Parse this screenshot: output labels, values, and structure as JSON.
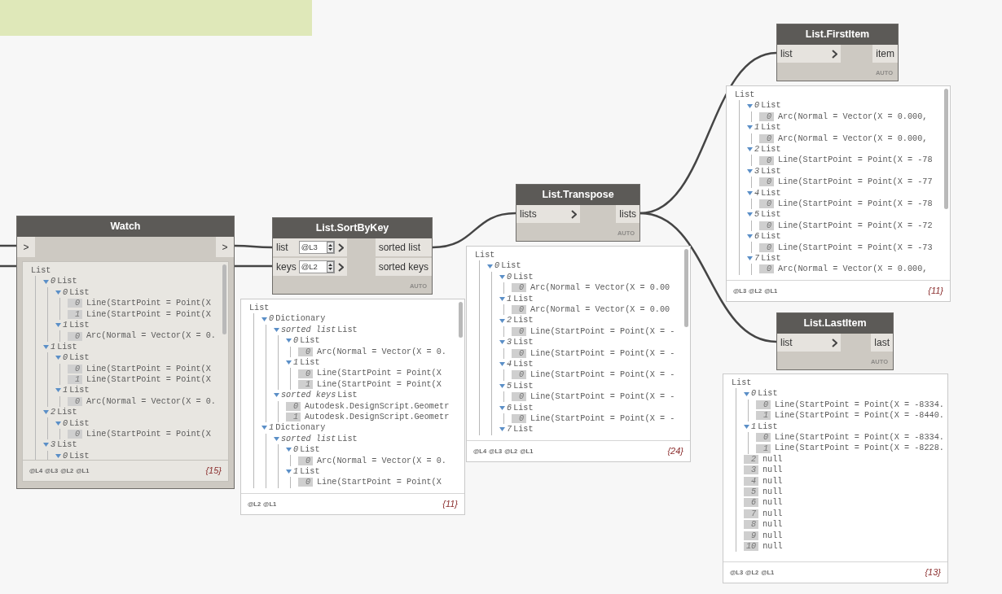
{
  "nodes": [
    {
      "kind": "watch",
      "title": "Watch",
      "inputs": [
        {
          "label": ">"
        }
      ],
      "outputs": [
        {
          "label": ">"
        }
      ],
      "preview": {
        "tree": {
          "kind": "list",
          "text": "List",
          "children": [
            {
              "kind": "list",
              "index": "0",
              "text": "List",
              "children": [
                {
                  "kind": "list",
                  "index": "0",
                  "text": "List",
                  "children": [
                    {
                      "kind": "item",
                      "index": "0",
                      "text": "Line(StartPoint = Point(X"
                    },
                    {
                      "kind": "item",
                      "index": "1",
                      "text": "Line(StartPoint = Point(X"
                    }
                  ]
                },
                {
                  "kind": "list",
                  "index": "1",
                  "text": "List",
                  "children": [
                    {
                      "kind": "item",
                      "index": "0",
                      "text": "Arc(Normal = Vector(X = 0."
                    }
                  ]
                }
              ]
            },
            {
              "kind": "list",
              "index": "1",
              "text": "List",
              "children": [
                {
                  "kind": "list",
                  "index": "0",
                  "text": "List",
                  "children": [
                    {
                      "kind": "item",
                      "index": "0",
                      "text": "Line(StartPoint = Point(X"
                    },
                    {
                      "kind": "item",
                      "index": "1",
                      "text": "Line(StartPoint = Point(X"
                    }
                  ]
                },
                {
                  "kind": "list",
                  "index": "1",
                  "text": "List",
                  "children": [
                    {
                      "kind": "item",
                      "index": "0",
                      "text": "Arc(Normal = Vector(X = 0."
                    }
                  ]
                }
              ]
            },
            {
              "kind": "list",
              "index": "2",
              "text": "List",
              "children": [
                {
                  "kind": "list",
                  "index": "0",
                  "text": "List",
                  "children": [
                    {
                      "kind": "item",
                      "index": "0",
                      "text": "Line(StartPoint = Point(X"
                    }
                  ]
                }
              ]
            },
            {
              "kind": "list",
              "index": "3",
              "text": "List",
              "children": [
                {
                  "kind": "list",
                  "index": "0",
                  "text": "List"
                }
              ]
            }
          ]
        },
        "levels": [
          "@L4",
          "@L3",
          "@L2",
          "@L1"
        ],
        "count": "{15}"
      }
    },
    {
      "kind": "function",
      "title": "List.SortByKey",
      "inputs": [
        {
          "label": "list",
          "lacing": "@L3"
        },
        {
          "label": "keys",
          "lacing": "@L2"
        }
      ],
      "outputs": [
        {
          "label": "sorted list"
        },
        {
          "label": "sorted keys"
        }
      ],
      "mode": "AUTO",
      "preview": {
        "tree": {
          "kind": "list",
          "text": "List",
          "children": [
            {
              "kind": "list",
              "index": "0",
              "text": "Dictionary",
              "children": [
                {
                  "kind": "list",
                  "key": "sorted list",
                  "text": "List",
                  "children": [
                    {
                      "kind": "list",
                      "index": "0",
                      "text": "List",
                      "children": [
                        {
                          "kind": "item",
                          "index": "0",
                          "text": "Arc(Normal = Vector(X = 0."
                        }
                      ]
                    },
                    {
                      "kind": "list",
                      "index": "1",
                      "text": "List",
                      "children": [
                        {
                          "kind": "item",
                          "index": "0",
                          "text": "Line(StartPoint = Point(X"
                        },
                        {
                          "kind": "item",
                          "index": "1",
                          "text": "Line(StartPoint = Point(X"
                        }
                      ]
                    }
                  ]
                },
                {
                  "kind": "list",
                  "key": "sorted keys",
                  "text": "List",
                  "children": [
                    {
                      "kind": "item",
                      "index": "0",
                      "text": "Autodesk.DesignScript.Geometr"
                    },
                    {
                      "kind": "item",
                      "index": "1",
                      "text": "Autodesk.DesignScript.Geometr"
                    }
                  ]
                }
              ]
            },
            {
              "kind": "list",
              "index": "1",
              "text": "Dictionary",
              "children": [
                {
                  "kind": "list",
                  "key": "sorted list",
                  "text": "List",
                  "children": [
                    {
                      "kind": "list",
                      "index": "0",
                      "text": "List",
                      "children": [
                        {
                          "kind": "item",
                          "index": "0",
                          "text": "Arc(Normal = Vector(X = 0."
                        }
                      ]
                    },
                    {
                      "kind": "list",
                      "index": "1",
                      "text": "List",
                      "children": [
                        {
                          "kind": "item",
                          "index": "0",
                          "text": "Line(StartPoint = Point(X"
                        }
                      ]
                    }
                  ]
                }
              ]
            }
          ]
        },
        "levels": [
          "@L2",
          "@L1"
        ],
        "count": "{11}"
      }
    },
    {
      "kind": "function",
      "title": "List.Transpose",
      "inputs": [
        {
          "label": "lists"
        }
      ],
      "outputs": [
        {
          "label": "lists"
        }
      ],
      "mode": "AUTO",
      "preview": {
        "tree": {
          "kind": "list",
          "text": "List",
          "children": [
            {
              "kind": "list",
              "index": "0",
              "text": "List",
              "children": [
                {
                  "kind": "list",
                  "index": "0",
                  "text": "List",
                  "children": [
                    {
                      "kind": "item",
                      "index": "0",
                      "text": "Arc(Normal = Vector(X = 0.00"
                    }
                  ]
                },
                {
                  "kind": "list",
                  "index": "1",
                  "text": "List",
                  "children": [
                    {
                      "kind": "item",
                      "index": "0",
                      "text": "Arc(Normal = Vector(X = 0.00"
                    }
                  ]
                },
                {
                  "kind": "list",
                  "index": "2",
                  "text": "List",
                  "children": [
                    {
                      "kind": "item",
                      "index": "0",
                      "text": "Line(StartPoint = Point(X = -"
                    }
                  ]
                },
                {
                  "kind": "list",
                  "index": "3",
                  "text": "List",
                  "children": [
                    {
                      "kind": "item",
                      "index": "0",
                      "text": "Line(StartPoint = Point(X = -"
                    }
                  ]
                },
                {
                  "kind": "list",
                  "index": "4",
                  "text": "List",
                  "children": [
                    {
                      "kind": "item",
                      "index": "0",
                      "text": "Line(StartPoint = Point(X = -"
                    }
                  ]
                },
                {
                  "kind": "list",
                  "index": "5",
                  "text": "List",
                  "children": [
                    {
                      "kind": "item",
                      "index": "0",
                      "text": "Line(StartPoint = Point(X = -"
                    }
                  ]
                },
                {
                  "kind": "list",
                  "index": "6",
                  "text": "List",
                  "children": [
                    {
                      "kind": "item",
                      "index": "0",
                      "text": "Line(StartPoint = Point(X = -"
                    }
                  ]
                },
                {
                  "kind": "list",
                  "index": "7",
                  "text": "List"
                }
              ]
            }
          ]
        },
        "levels": [
          "@L4",
          "@L3",
          "@L2",
          "@L1"
        ],
        "count": "{24}"
      }
    },
    {
      "kind": "function",
      "title": "List.FirstItem",
      "inputs": [
        {
          "label": "list"
        }
      ],
      "outputs": [
        {
          "label": "item"
        }
      ],
      "mode": "AUTO",
      "preview": {
        "tree": {
          "kind": "list",
          "text": "List",
          "children": [
            {
              "kind": "list",
              "index": "0",
              "text": "List",
              "children": [
                {
                  "kind": "item",
                  "index": "0",
                  "text": "Arc(Normal = Vector(X = 0.000,"
                }
              ]
            },
            {
              "kind": "list",
              "index": "1",
              "text": "List",
              "children": [
                {
                  "kind": "item",
                  "index": "0",
                  "text": "Arc(Normal = Vector(X = 0.000,"
                }
              ]
            },
            {
              "kind": "list",
              "index": "2",
              "text": "List",
              "children": [
                {
                  "kind": "item",
                  "index": "0",
                  "text": "Line(StartPoint = Point(X = -78"
                }
              ]
            },
            {
              "kind": "list",
              "index": "3",
              "text": "List",
              "children": [
                {
                  "kind": "item",
                  "index": "0",
                  "text": "Line(StartPoint = Point(X = -77"
                }
              ]
            },
            {
              "kind": "list",
              "index": "4",
              "text": "List",
              "children": [
                {
                  "kind": "item",
                  "index": "0",
                  "text": "Line(StartPoint = Point(X = -78"
                }
              ]
            },
            {
              "kind": "list",
              "index": "5",
              "text": "List",
              "children": [
                {
                  "kind": "item",
                  "index": "0",
                  "text": "Line(StartPoint = Point(X = -72"
                }
              ]
            },
            {
              "kind": "list",
              "index": "6",
              "text": "List",
              "children": [
                {
                  "kind": "item",
                  "index": "0",
                  "text": "Line(StartPoint = Point(X = -73"
                }
              ]
            },
            {
              "kind": "list",
              "index": "7",
              "text": "List",
              "children": [
                {
                  "kind": "item",
                  "index": "0",
                  "text": "Arc(Normal = Vector(X = 0.000,"
                }
              ]
            }
          ]
        },
        "levels": [
          "@L3",
          "@L2",
          "@L1"
        ],
        "count": "{11}"
      }
    },
    {
      "kind": "function",
      "title": "List.LastItem",
      "inputs": [
        {
          "label": "list"
        }
      ],
      "outputs": [
        {
          "label": "last"
        }
      ],
      "mode": "AUTO",
      "preview": {
        "tree": {
          "kind": "list",
          "text": "List",
          "children": [
            {
              "kind": "list",
              "index": "0",
              "text": "List",
              "children": [
                {
                  "kind": "item",
                  "index": "0",
                  "text": "Line(StartPoint = Point(X = -8334."
                },
                {
                  "kind": "item",
                  "index": "1",
                  "text": "Line(StartPoint = Point(X = -8440."
                }
              ]
            },
            {
              "kind": "list",
              "index": "1",
              "text": "List",
              "children": [
                {
                  "kind": "item",
                  "index": "0",
                  "text": "Line(StartPoint = Point(X = -8334."
                },
                {
                  "kind": "item",
                  "index": "1",
                  "text": "Line(StartPoint = Point(X = -8228."
                }
              ]
            },
            {
              "kind": "item",
              "index": "2",
              "text": "null"
            },
            {
              "kind": "item",
              "index": "3",
              "text": "null"
            },
            {
              "kind": "item",
              "index": "4",
              "text": "null"
            },
            {
              "kind": "item",
              "index": "5",
              "text": "null"
            },
            {
              "kind": "item",
              "index": "6",
              "text": "null"
            },
            {
              "kind": "item",
              "index": "7",
              "text": "null"
            },
            {
              "kind": "item",
              "index": "8",
              "text": "null"
            },
            {
              "kind": "item",
              "index": "9",
              "text": "null"
            },
            {
              "kind": "item",
              "index": "10",
              "text": "null"
            }
          ]
        },
        "levels": [
          "@L3",
          "@L2",
          "@L1"
        ],
        "count": "{13}"
      }
    }
  ]
}
